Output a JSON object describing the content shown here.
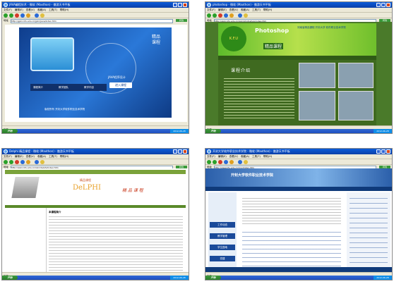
{
  "panels": [
    {
      "id": "p1",
      "window_title": "JAVA编程技术 - 微软 (Maxthon) - 傲游天书平板",
      "menu": [
        "文件(F)",
        "编辑(E)",
        "查看(V)",
        "收藏(A)",
        "工具(T)",
        "帮助(H)"
      ],
      "address": "http://gpkc.kfu.edu.cn/jpkc/java/index.htm",
      "go_label": "转到",
      "content": {
        "vertical_title": "精品课程",
        "java_caption": "JAVA程序设计",
        "enter_label": "进入课程",
        "nav_items": [
          "课程简介",
          "教学团队",
          "教学内容"
        ],
        "footer": "版权所有 开封大学软件职业技术学院"
      },
      "status": "完毕",
      "tray_time": "2012-06-28"
    },
    {
      "id": "p2",
      "window_title": "photoshop - 微软 (Maxthon) - 傲游天书平板",
      "menu": [
        "文件(F)",
        "编辑(E)",
        "查看(V)",
        "收藏(A)",
        "工具(T)",
        "帮助(H)"
      ],
      "address": "http://gpkc.kfu.edu.cn/jpkc/photoshop/index.htm",
      "go_label": "转到",
      "content": {
        "logo_text": "K.F.U SOFTWARE COLLEGE",
        "photoshop": "Photoshop",
        "subtitle": "河南省精品课程 开封大学 软件职业技术学院",
        "jp_label": "精品课程",
        "intro": "课程介绍"
      },
      "status": "完毕",
      "tray_time": "2012-06-28"
    },
    {
      "id": "p3",
      "window_title": "Delphi 精品课程 - 微软 (Maxthon) - 傲游天书平板",
      "menu": [
        "文件(F)",
        "编辑(E)",
        "查看(V)",
        "收藏(A)",
        "工具(T)",
        "帮助(H)"
      ],
      "address": "http://gpkc.kfu.edu.cn/jpkc/delphi/index.htm",
      "go_label": "转到",
      "content": {
        "nav": [
          "首页",
          "课程简介",
          "教学团队",
          "教学内容",
          "教学资源",
          "实践教学"
        ],
        "label": "精品课程",
        "delphi": "DeLPHI",
        "jp_label": "精 品 课 程",
        "heading": "本课程简介"
      },
      "status": "完毕",
      "tray_time": "2012-06-28"
    },
    {
      "id": "p4",
      "window_title": "开封大学软件职业技术学院 - 微软 (Maxthon) - 傲游天书平板",
      "menu": [
        "文件(F)",
        "编辑(E)",
        "查看(V)",
        "收藏(A)",
        "工具(T)",
        "帮助(H)"
      ],
      "address": "http://www.kfu.edu.cn/rjxy/index.htm",
      "go_label": "转到",
      "content": {
        "title": "开封大学软件职业技术学院",
        "nav": [
          "首页",
          "学院概况",
          "机构设置",
          "教学科研",
          "招生就业",
          "学生工作"
        ],
        "side_buttons": [
          "工作动态",
          "教学管理",
          "学生园地",
          "党建"
        ]
      },
      "status": "完毕",
      "tray_time": "2012-06-28"
    }
  ],
  "common": {
    "start_label": "开始",
    "address_label": "地址"
  }
}
